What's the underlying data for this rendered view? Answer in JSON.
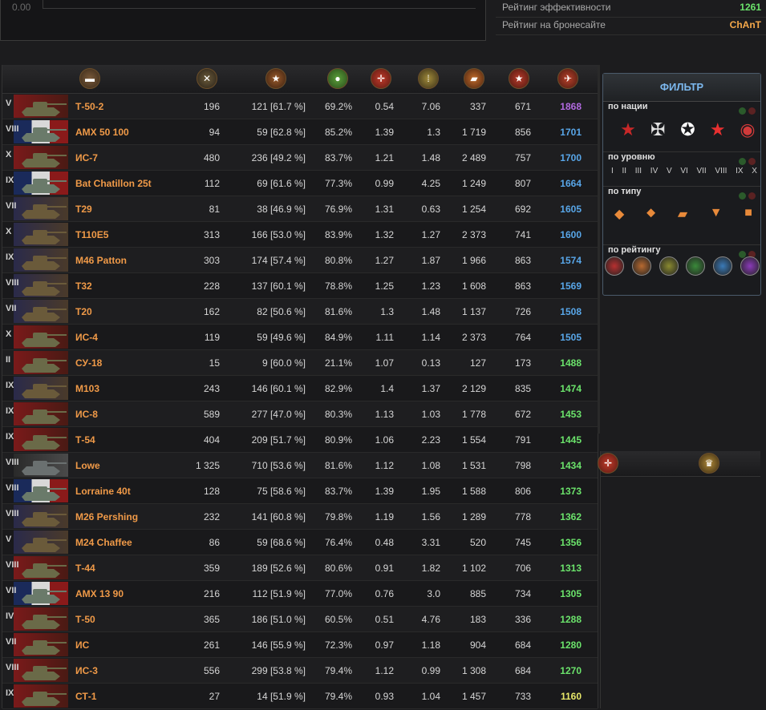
{
  "top_chart": {
    "zero_label": "0.00"
  },
  "ratings": [
    {
      "label": "Рейтинг эффективности",
      "value": "1261",
      "color": "#6be36b"
    },
    {
      "label": "Рейтинг на бронесайте",
      "value": "ChAnT",
      "color": "#f5a84a"
    }
  ],
  "header_icons": [
    "tank-icon",
    "crossed-swords-icon",
    "star-medal-icon",
    "green-circle-icon",
    "red-crosshair-icon",
    "shells-icon",
    "tank-damage-icon",
    "red-star-icon",
    "rating-icon"
  ],
  "rows": [
    {
      "tier": "V",
      "name": "Т-50-2",
      "battles": "196",
      "wins": "121 [61.7 %]",
      "survival": "69.2%",
      "frags": "0.54",
      "spots": "7.06",
      "damage": "337",
      "xp": "671",
      "rating": "1868",
      "rating_color": "#b26ae0",
      "flag": "ussr"
    },
    {
      "tier": "VIII",
      "name": "AMX 50 100",
      "battles": "94",
      "wins": "59 [62.8 %]",
      "survival": "85.2%",
      "frags": "1.39",
      "spots": "1.3",
      "damage": "1 719",
      "xp": "856",
      "rating": "1701",
      "rating_color": "#58a6e8",
      "flag": "fr"
    },
    {
      "tier": "X",
      "name": "ИС-7",
      "battles": "480",
      "wins": "236 [49.2 %]",
      "survival": "83.7%",
      "frags": "1.21",
      "spots": "1.48",
      "damage": "2 489",
      "xp": "757",
      "rating": "1700",
      "rating_color": "#58a6e8",
      "flag": "ussr"
    },
    {
      "tier": "IX",
      "name": "Bat Chatillon 25t",
      "battles": "112",
      "wins": "69 [61.6 %]",
      "survival": "77.3%",
      "frags": "0.99",
      "spots": "4.25",
      "damage": "1 249",
      "xp": "807",
      "rating": "1664",
      "rating_color": "#58a6e8",
      "flag": "fr"
    },
    {
      "tier": "VII",
      "name": "T29",
      "battles": "81",
      "wins": "38 [46.9 %]",
      "survival": "76.9%",
      "frags": "1.31",
      "spots": "0.63",
      "damage": "1 254",
      "xp": "692",
      "rating": "1605",
      "rating_color": "#58a6e8",
      "flag": "us"
    },
    {
      "tier": "X",
      "name": "T110E5",
      "battles": "313",
      "wins": "166 [53.0 %]",
      "survival": "83.9%",
      "frags": "1.32",
      "spots": "1.27",
      "damage": "2 373",
      "xp": "741",
      "rating": "1600",
      "rating_color": "#58a6e8",
      "flag": "us"
    },
    {
      "tier": "IX",
      "name": "M46 Patton",
      "battles": "303",
      "wins": "174 [57.4 %]",
      "survival": "80.8%",
      "frags": "1.27",
      "spots": "1.87",
      "damage": "1 966",
      "xp": "863",
      "rating": "1574",
      "rating_color": "#58a6e8",
      "flag": "us"
    },
    {
      "tier": "VIII",
      "name": "T32",
      "battles": "228",
      "wins": "137 [60.1 %]",
      "survival": "78.8%",
      "frags": "1.25",
      "spots": "1.23",
      "damage": "1 608",
      "xp": "863",
      "rating": "1569",
      "rating_color": "#58a6e8",
      "flag": "us"
    },
    {
      "tier": "VII",
      "name": "T20",
      "battles": "162",
      "wins": "82 [50.6 %]",
      "survival": "81.6%",
      "frags": "1.3",
      "spots": "1.48",
      "damage": "1 137",
      "xp": "726",
      "rating": "1508",
      "rating_color": "#58a6e8",
      "flag": "us"
    },
    {
      "tier": "X",
      "name": "ИС-4",
      "battles": "119",
      "wins": "59 [49.6 %]",
      "survival": "84.9%",
      "frags": "1.11",
      "spots": "1.14",
      "damage": "2 373",
      "xp": "764",
      "rating": "1505",
      "rating_color": "#58a6e8",
      "flag": "ussr"
    },
    {
      "tier": "II",
      "name": "СУ-18",
      "battles": "15",
      "wins": "9 [60.0 %]",
      "survival": "21.1%",
      "frags": "1.07",
      "spots": "0.13",
      "damage": "127",
      "xp": "173",
      "rating": "1488",
      "rating_color": "#6be36b",
      "flag": "ussr"
    },
    {
      "tier": "IX",
      "name": "M103",
      "battles": "243",
      "wins": "146 [60.1 %]",
      "survival": "82.9%",
      "frags": "1.4",
      "spots": "1.37",
      "damage": "2 129",
      "xp": "835",
      "rating": "1474",
      "rating_color": "#6be36b",
      "flag": "us"
    },
    {
      "tier": "IX",
      "name": "ИС-8",
      "battles": "589",
      "wins": "277 [47.0 %]",
      "survival": "80.3%",
      "frags": "1.13",
      "spots": "1.03",
      "damage": "1 778",
      "xp": "672",
      "rating": "1453",
      "rating_color": "#6be36b",
      "flag": "ussr"
    },
    {
      "tier": "IX",
      "name": "Т-54",
      "battles": "404",
      "wins": "209 [51.7 %]",
      "survival": "80.9%",
      "frags": "1.06",
      "spots": "2.23",
      "damage": "1 554",
      "xp": "791",
      "rating": "1445",
      "rating_color": "#6be36b",
      "flag": "ussr"
    },
    {
      "tier": "VIII",
      "name": "Lowe",
      "battles": "1 325",
      "wins": "710 [53.6 %]",
      "survival": "81.6%",
      "frags": "1.12",
      "spots": "1.08",
      "damage": "1 531",
      "xp": "798",
      "rating": "1434",
      "rating_color": "#6be36b",
      "flag": "de"
    },
    {
      "tier": "VIII",
      "name": "Lorraine 40t",
      "battles": "128",
      "wins": "75 [58.6 %]",
      "survival": "83.7%",
      "frags": "1.39",
      "spots": "1.95",
      "damage": "1 588",
      "xp": "806",
      "rating": "1373",
      "rating_color": "#6be36b",
      "flag": "fr"
    },
    {
      "tier": "VIII",
      "name": "M26 Pershing",
      "battles": "232",
      "wins": "141 [60.8 %]",
      "survival": "79.8%",
      "frags": "1.19",
      "spots": "1.56",
      "damage": "1 289",
      "xp": "778",
      "rating": "1362",
      "rating_color": "#6be36b",
      "flag": "us"
    },
    {
      "tier": "V",
      "name": "M24 Chaffee",
      "battles": "86",
      "wins": "59 [68.6 %]",
      "survival": "76.4%",
      "frags": "0.48",
      "spots": "3.31",
      "damage": "520",
      "xp": "745",
      "rating": "1356",
      "rating_color": "#6be36b",
      "flag": "us"
    },
    {
      "tier": "VIII",
      "name": "Т-44",
      "battles": "359",
      "wins": "189 [52.6 %]",
      "survival": "80.6%",
      "frags": "0.91",
      "spots": "1.82",
      "damage": "1 102",
      "xp": "706",
      "rating": "1313",
      "rating_color": "#6be36b",
      "flag": "ussr"
    },
    {
      "tier": "VII",
      "name": "AMX 13 90",
      "battles": "216",
      "wins": "112 [51.9 %]",
      "survival": "77.0%",
      "frags": "0.76",
      "spots": "3.0",
      "damage": "885",
      "xp": "734",
      "rating": "1305",
      "rating_color": "#6be36b",
      "flag": "fr"
    },
    {
      "tier": "IV",
      "name": "Т-50",
      "battles": "365",
      "wins": "186 [51.0 %]",
      "survival": "60.5%",
      "frags": "0.51",
      "spots": "4.76",
      "damage": "183",
      "xp": "336",
      "rating": "1288",
      "rating_color": "#6be36b",
      "flag": "ussr"
    },
    {
      "tier": "VII",
      "name": "ИС",
      "battles": "261",
      "wins": "146 [55.9 %]",
      "survival": "72.3%",
      "frags": "0.97",
      "spots": "1.18",
      "damage": "904",
      "xp": "684",
      "rating": "1280",
      "rating_color": "#6be36b",
      "flag": "ussr"
    },
    {
      "tier": "VIII",
      "name": "ИС-3",
      "battles": "556",
      "wins": "299 [53.8 %]",
      "survival": "79.4%",
      "frags": "1.12",
      "spots": "0.99",
      "damage": "1 308",
      "xp": "684",
      "rating": "1270",
      "rating_color": "#6be36b",
      "flag": "ussr"
    },
    {
      "tier": "IX",
      "name": "СТ-1",
      "battles": "27",
      "wins": "14 [51.9 %]",
      "survival": "79.4%",
      "frags": "0.93",
      "spots": "1.04",
      "damage": "1 457",
      "xp": "733",
      "rating": "1160",
      "rating_color": "#e8e86a",
      "flag": "ussr"
    }
  ],
  "filter": {
    "title": "ФИЛЬТР",
    "by_nation": "по нации",
    "by_level": "по уровню",
    "by_type": "по типу",
    "by_rating": "по рейтингу",
    "levels": [
      "I",
      "II",
      "III",
      "IV",
      "V",
      "VI",
      "VII",
      "VIII",
      "IX",
      "X"
    ],
    "nation_icons": [
      "ussr-star-icon",
      "germany-cross-icon",
      "usa-star-icon",
      "china-star-icon",
      "france-roundel-icon"
    ],
    "type_icons": [
      "light-tank-icon",
      "medium-tank-icon",
      "heavy-tank-icon",
      "td-icon",
      "spg-icon"
    ],
    "rating_colors": [
      "#b83030",
      "#b86a30",
      "#8a8a30",
      "#3a8a3a",
      "#3a7ab8",
      "#8a3ab8"
    ]
  },
  "side_panel": {
    "icons": [
      "red-crosshair-icon",
      "trophy-icon"
    ]
  }
}
